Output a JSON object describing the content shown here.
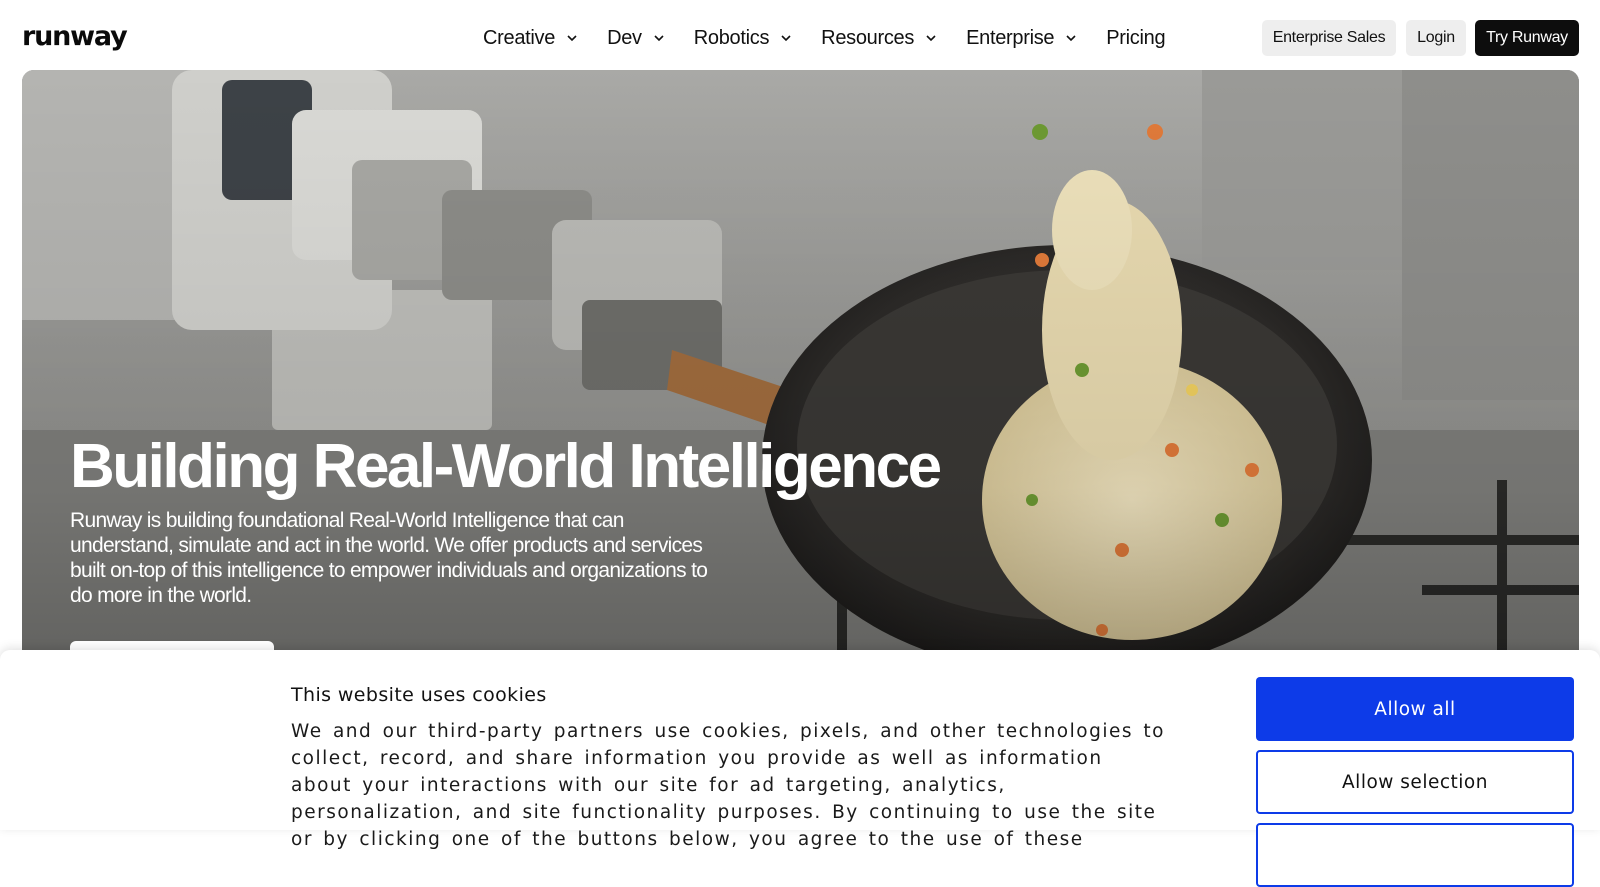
{
  "header": {
    "logo": "runway",
    "nav": [
      {
        "label": "Creative",
        "has_dropdown": true
      },
      {
        "label": "Dev",
        "has_dropdown": true
      },
      {
        "label": "Robotics",
        "has_dropdown": true
      },
      {
        "label": "Resources",
        "has_dropdown": true
      },
      {
        "label": "Enterprise",
        "has_dropdown": true
      },
      {
        "label": "Pricing",
        "has_dropdown": false
      }
    ],
    "enterprise_sales_label": "Enterprise Sales",
    "login_label": "Login",
    "try_label": "Try Runway"
  },
  "hero": {
    "title": "Building Real-World Intelligence",
    "description": "Runway is building foundational Real-World Intelligence that can understand, simulate and act in the world. We offer products and services built on-top of this intelligence to empower individuals and organizations to do more in the world."
  },
  "cookie": {
    "title": "This website uses cookies",
    "text": "We and our third-party partners use cookies, pixels, and other technologies to collect, record, and share information you provide as well as information about your interactions with our site for ad targeting, analytics, personalization, and site functionality purposes. By continuing to use the site or by clicking one of the buttons below, you agree to the use of these",
    "allow_all_label": "Allow all",
    "allow_selection_label": "Allow selection"
  },
  "colors": {
    "accent": "#0d3be8",
    "dark_button": "#0d0d0d",
    "light_button": "#eeeeee"
  }
}
